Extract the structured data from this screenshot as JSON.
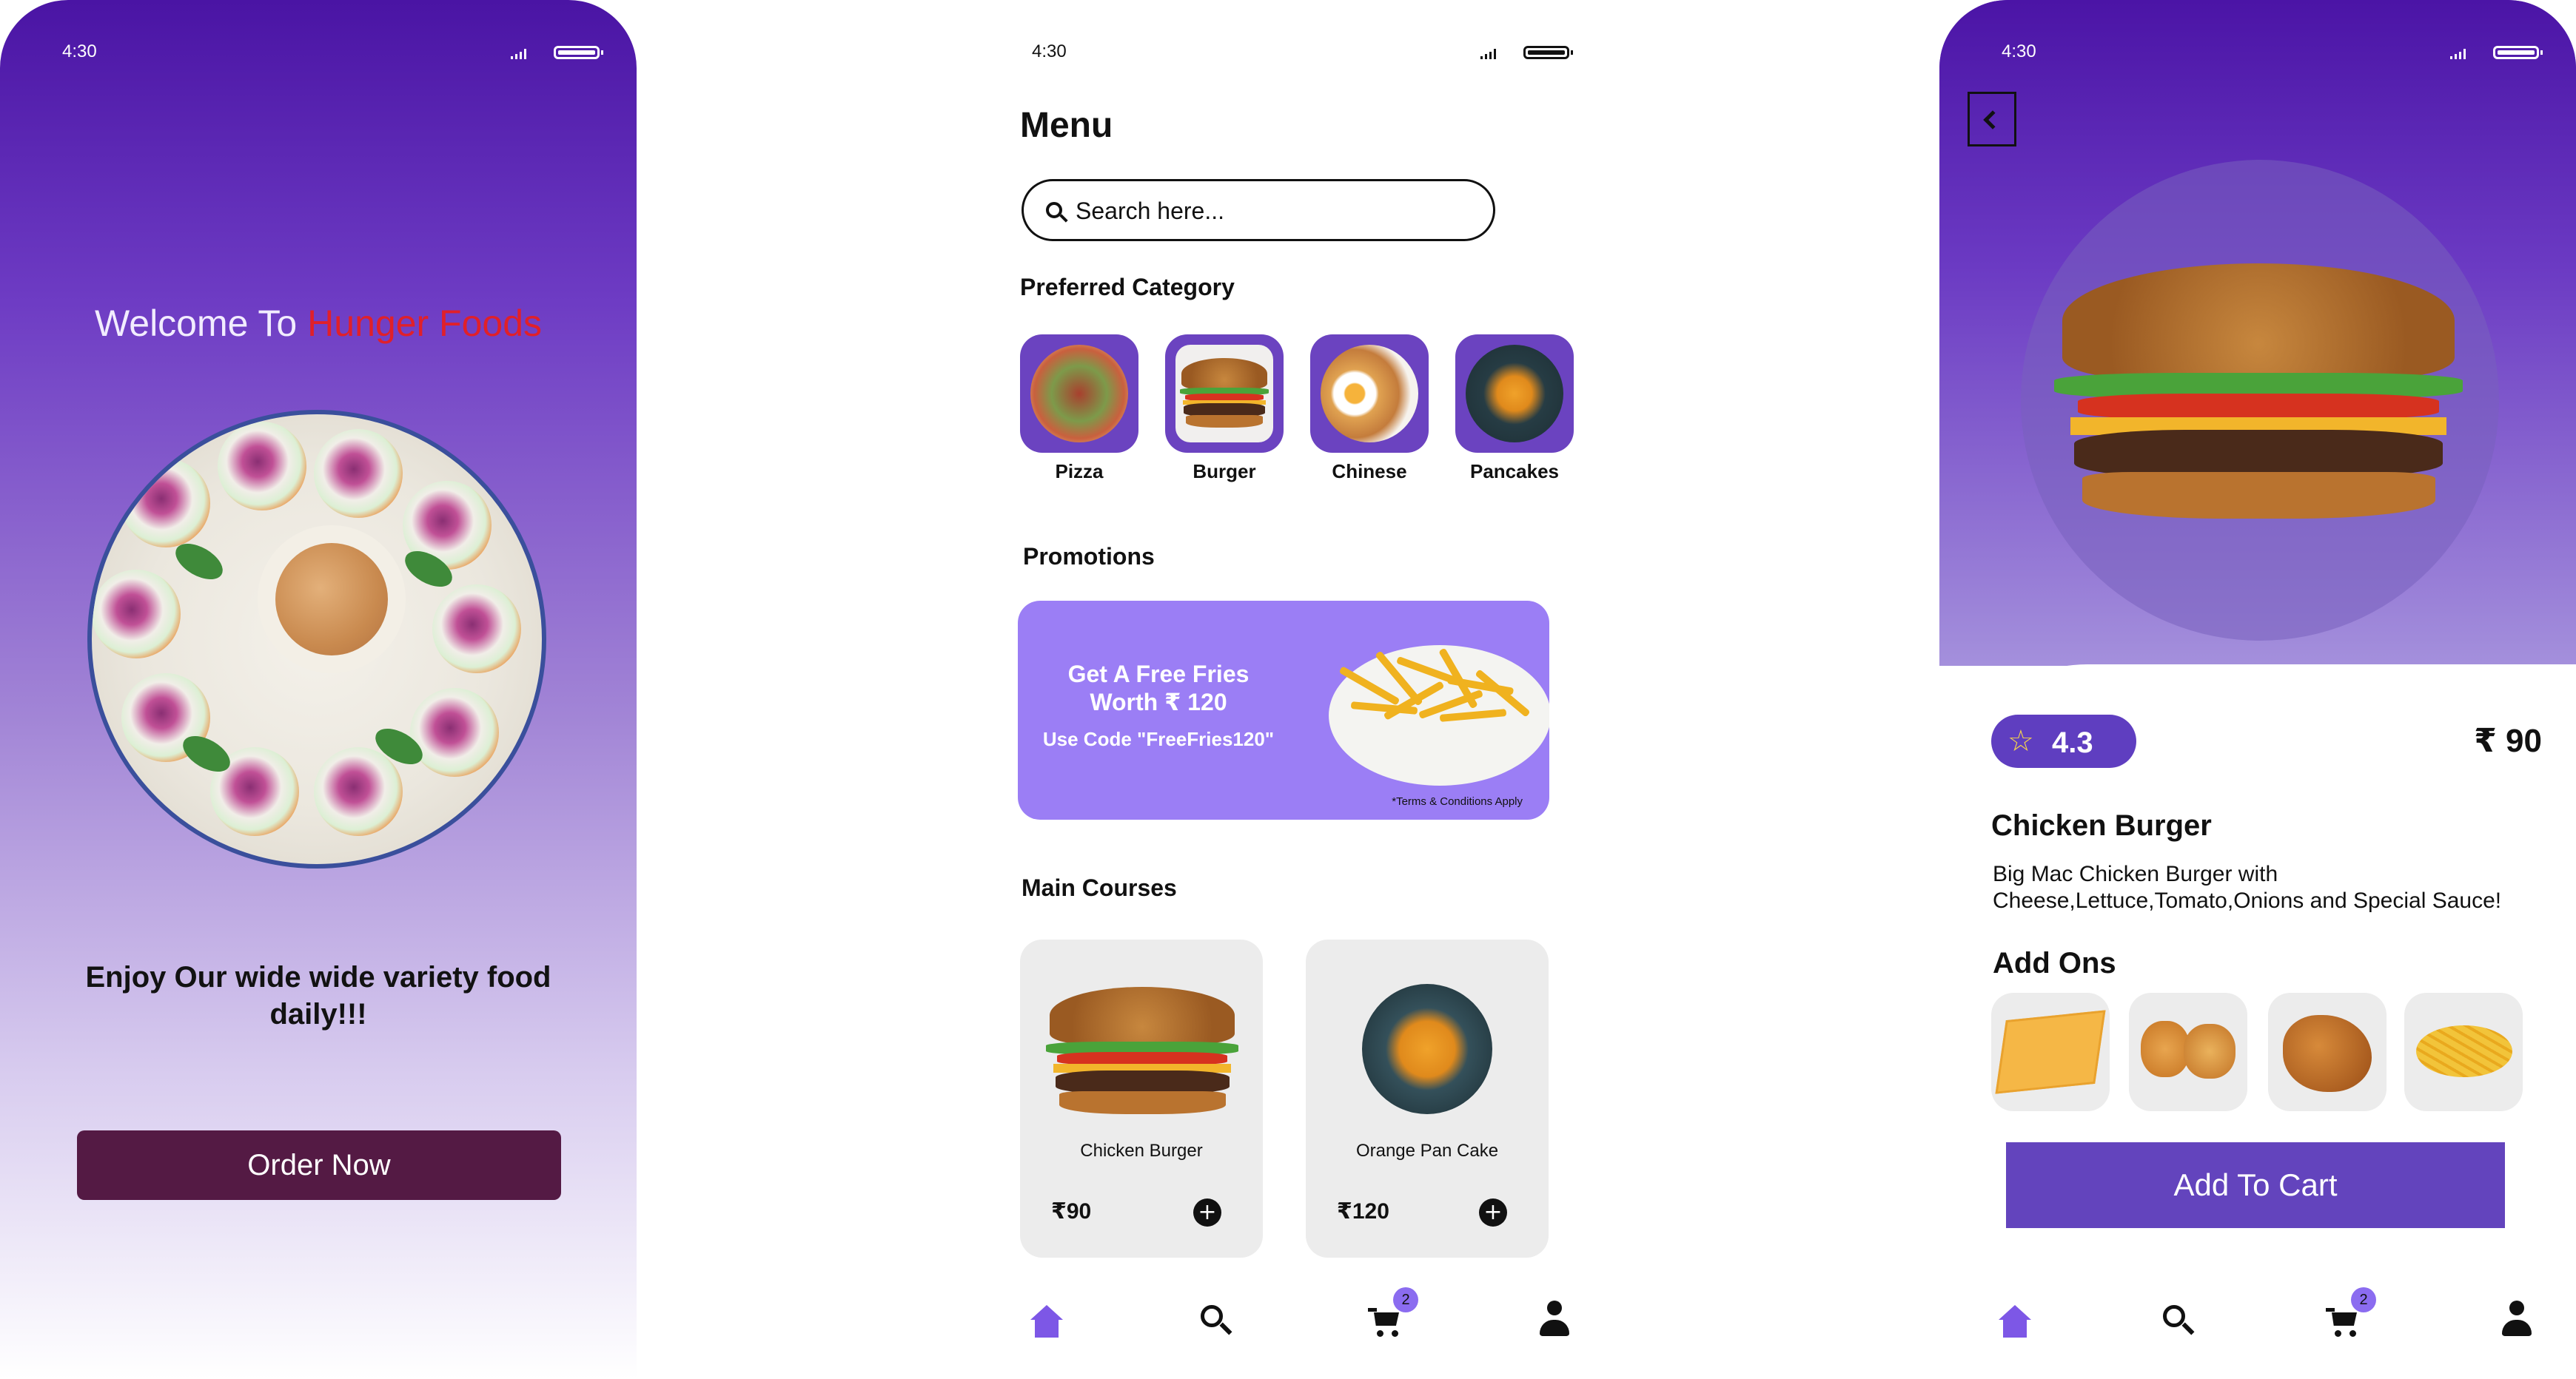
{
  "screens": {
    "welcome": {
      "status_time": "4:30",
      "title_prefix": "Welcome To",
      "title_brand": "Hunger Foods",
      "tagline": "Enjoy Our wide wide variety food daily!!!",
      "cta_label": "Order Now"
    },
    "menu": {
      "status_time": "4:30",
      "title": "Menu",
      "search_placeholder": "Search here...",
      "preferred_category_title": "Preferred Category",
      "categories": [
        {
          "label": "Pizza"
        },
        {
          "label": "Burger"
        },
        {
          "label": "Chinese"
        },
        {
          "label": "Pancakes"
        }
      ],
      "promotions_title": "Promotions",
      "promo": {
        "line1": "Get A Free Fries",
        "line2": "Worth ₹ 120",
        "code_line": "Use Code \"FreeFries120\"",
        "terms": "*Terms & Conditions Apply"
      },
      "main_courses_title": "Main Courses",
      "courses": [
        {
          "name": "Chicken Burger",
          "price": "₹90"
        },
        {
          "name": "Orange Pan Cake",
          "price": "₹120"
        }
      ],
      "cart_count": "2"
    },
    "detail": {
      "status_time": "4:30",
      "rating": "4.3",
      "price": "₹ 90",
      "title": "Chicken Burger",
      "description": "Big Mac Chicken Burger with Cheese,Lettuce,Tomato,Onions and  Special Sauce!",
      "addons_title": "Add Ons",
      "cta_label": "Add To Cart",
      "cart_count": "2"
    }
  },
  "colors": {
    "primary_purple": "#5f3ec0",
    "promo_purple": "#9b7ef5",
    "order_button": "#541a44",
    "brand_red": "#e0202a",
    "nav_active": "#7d57e6"
  },
  "icons": [
    "search-icon",
    "home-icon",
    "cart-icon",
    "user-icon",
    "back-icon",
    "star-icon",
    "plus-icon"
  ]
}
